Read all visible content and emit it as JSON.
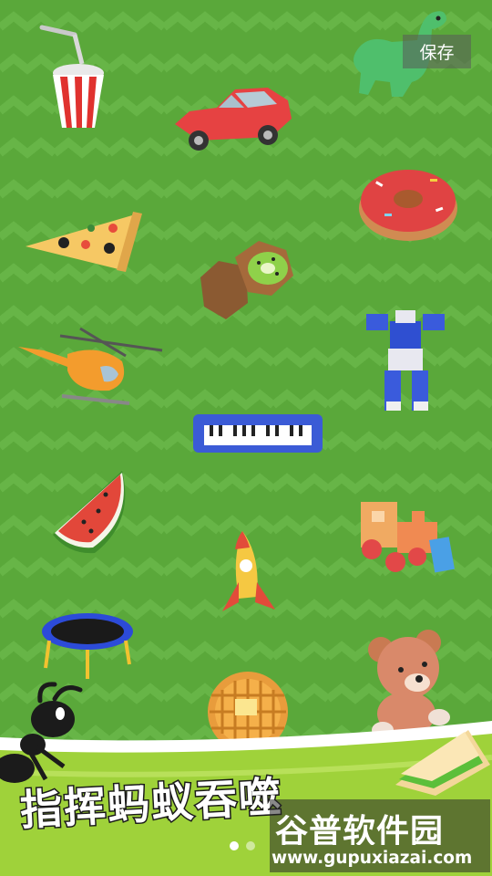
{
  "screen": {
    "save_label": "保存"
  },
  "collection": [
    {
      "name": "soda-cup"
    },
    {
      "name": "red-car"
    },
    {
      "name": "green-dinosaur"
    },
    {
      "name": "pizza-slice"
    },
    {
      "name": "kiwi-fruit"
    },
    {
      "name": "donut"
    },
    {
      "name": "helicopter"
    },
    {
      "name": "keyboard"
    },
    {
      "name": "robot"
    },
    {
      "name": "watermelon-slice"
    },
    {
      "name": "rocket"
    },
    {
      "name": "toy-train"
    },
    {
      "name": "trampoline"
    },
    {
      "name": "waffle"
    },
    {
      "name": "teddy-bear"
    },
    {
      "name": "sandwich"
    }
  ],
  "banner": {
    "title": "指挥蚂蚁吞噬"
  },
  "watermark": {
    "brand": "谷普软件园",
    "url": "www.gupuxiazai.com"
  },
  "pagination": {
    "count": 2,
    "active": 0
  },
  "colors": {
    "background": "#5aa83a",
    "stripe": "#66b546",
    "banner": "#9fd23a",
    "ant": "#1b1b1b"
  }
}
